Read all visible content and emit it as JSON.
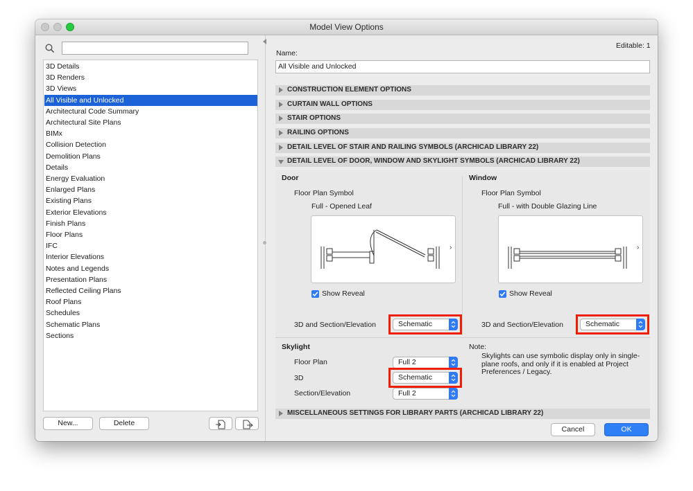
{
  "window": {
    "title": "Model View Options"
  },
  "left": {
    "search": {
      "value": "",
      "placeholder": ""
    },
    "items": [
      "3D Details",
      "3D Renders",
      "3D Views",
      "All Visible and Unlocked",
      "Architectural Code Summary",
      "Architectural Site Plans",
      "BIMx",
      "Collision Detection",
      "Demolition Plans",
      "Details",
      "Energy Evaluation",
      "Enlarged Plans",
      "Existing Plans",
      "Exterior Elevations",
      "Finish Plans",
      "Floor Plans",
      "IFC",
      "Interior Elevations",
      "Notes and Legends",
      "Presentation Plans",
      "Reflected Ceiling Plans",
      "Roof Plans",
      "Schedules",
      "Schematic Plans",
      "Sections"
    ],
    "selected_index": 3,
    "new_label": "New...",
    "delete_label": "Delete",
    "import_icon": "import-icon",
    "export_icon": "export-icon"
  },
  "right": {
    "editable": "Editable: 1",
    "name_label": "Name:",
    "name_value": "All Visible and Unlocked",
    "sections": [
      "CONSTRUCTION ELEMENT OPTIONS",
      "CURTAIN WALL OPTIONS",
      "STAIR OPTIONS",
      "RAILING OPTIONS",
      "DETAIL LEVEL OF STAIR AND RAILING SYMBOLS (ARCHICAD LIBRARY 22)",
      "DETAIL LEVEL OF DOOR, WINDOW AND SKYLIGHT SYMBOLS (ARCHICAD LIBRARY 22)"
    ],
    "misc_section": "MISCELLANEOUS SETTINGS FOR LIBRARY PARTS (ARCHICAD LIBRARY 22)",
    "door": {
      "heading": "Door",
      "symbol_label": "Floor Plan Symbol",
      "symbol_value": "Full - Opened Leaf",
      "show_reveal": "Show Reveal",
      "show_reveal_checked": true,
      "section_label": "3D and Section/Elevation",
      "section_value": "Schematic"
    },
    "window": {
      "heading": "Window",
      "symbol_label": "Floor Plan Symbol",
      "symbol_value": "Full - with Double Glazing Line",
      "show_reveal": "Show Reveal",
      "show_reveal_checked": true,
      "section_label": "3D and Section/Elevation",
      "section_value": "Schematic"
    },
    "skylight": {
      "heading": "Skylight",
      "floor_plan_label": "Floor Plan",
      "floor_plan_value": "Full 2",
      "threed_label": "3D",
      "threed_value": "Schematic",
      "section_label": "Section/Elevation",
      "section_value": "Full 2"
    },
    "note": {
      "label": "Note:",
      "text": "Skylights can use symbolic display only in single-plane roofs, and only if it is enabled at Project Preferences / Legacy."
    },
    "cancel_label": "Cancel",
    "ok_label": "OK"
  },
  "colors": {
    "accent": "#2f7bf5",
    "selection": "#1b62d8",
    "highlight": "#f01e00"
  }
}
